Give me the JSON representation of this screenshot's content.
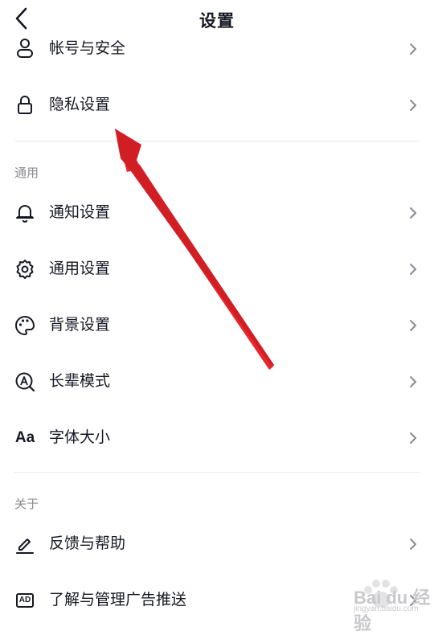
{
  "header": {
    "title": "设置"
  },
  "rows": {
    "account": {
      "label": "帐号与安全",
      "icon": "user-icon"
    },
    "privacy": {
      "label": "隐私设置",
      "icon": "lock-icon"
    },
    "notify": {
      "label": "通知设置",
      "icon": "bell-icon"
    },
    "general": {
      "label": "通用设置",
      "icon": "gear-icon"
    },
    "background": {
      "label": "背景设置",
      "icon": "palette-icon"
    },
    "elder": {
      "label": "长辈模式",
      "icon": "elder-mode-icon"
    },
    "font": {
      "label": "字体大小",
      "icon": "font-size-icon",
      "icon_text": "Aa"
    },
    "feedback": {
      "label": "反馈与帮助",
      "icon": "edit-icon"
    },
    "ads": {
      "label": "了解与管理广告推送",
      "icon": "ad-icon",
      "icon_text": "AD"
    }
  },
  "sections": {
    "general": "通用",
    "about": "关于"
  },
  "watermark": {
    "logo": "Bai du 经验",
    "sub": "jingyan.baidu.com"
  },
  "colors": {
    "annotation_arrow": "#e8262c",
    "text": "#161823",
    "secondary_text": "#8a8b91",
    "divider": "#e8e8ea"
  }
}
